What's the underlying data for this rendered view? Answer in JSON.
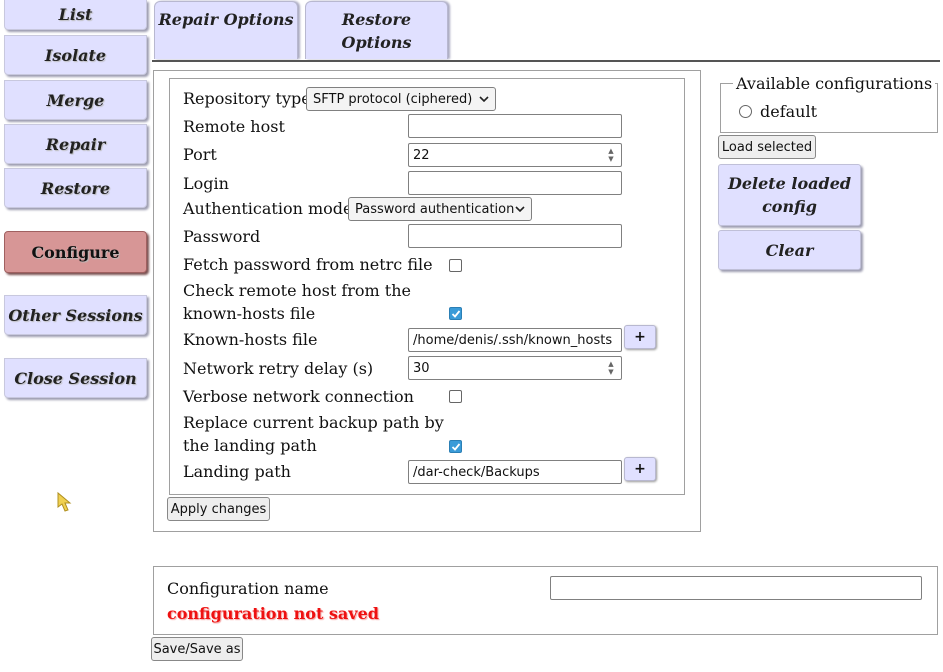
{
  "nav": {
    "list": "List",
    "isolate": "Isolate",
    "merge": "Merge",
    "repair": "Repair",
    "restore": "Restore",
    "configure": "Configure",
    "other_sessions": "Other Sessions",
    "close_session": "Close Session"
  },
  "tabs": {
    "repair_options": "Repair Options",
    "restore_options_line1": "Restore",
    "restore_options_line2": "Options"
  },
  "form": {
    "repository_type_label": "Repository type",
    "repository_type_value": "SFTP protocol (ciphered)",
    "remote_host_label": "Remote host",
    "remote_host_value": "",
    "port_label": "Port",
    "port_value": "22",
    "login_label": "Login",
    "login_value": "",
    "auth_mode_label": "Authentication mode",
    "auth_mode_value": "Password authentication",
    "password_label": "Password",
    "password_value": "",
    "netrc_label": "Fetch password from netrc file",
    "netrc_checked": false,
    "check_host_label_line1": "Check remote host from the",
    "check_host_label_line2": "known-hosts file",
    "check_host_checked": true,
    "known_hosts_label": "Known-hosts file",
    "known_hosts_value": "/home/denis/.ssh/known_hosts",
    "retry_delay_label": "Network retry delay (s)",
    "retry_delay_value": "30",
    "verbose_label": "Verbose network connection",
    "verbose_checked": false,
    "replace_path_label_line1": "Replace current backup path by",
    "replace_path_label_line2": "the landing path",
    "replace_path_checked": true,
    "landing_path_label": "Landing path",
    "landing_path_value": "/dar-check/Backups",
    "plus_label": "+",
    "apply_label": "Apply changes"
  },
  "configs": {
    "legend": "Available configurations",
    "options": [
      "default"
    ],
    "load_selected": "Load selected",
    "delete_line1": "Delete loaded",
    "delete_line2": "config",
    "clear": "Clear"
  },
  "save": {
    "name_label": "Configuration name",
    "name_value": "",
    "status": "configuration not saved",
    "save_button": "Save/Save as"
  },
  "colors": {
    "button_bg": "#e0e0ff",
    "active_button_bg": "#d79696",
    "status_red": "#ee1111",
    "checkbox_on": "#3a9bd8"
  }
}
